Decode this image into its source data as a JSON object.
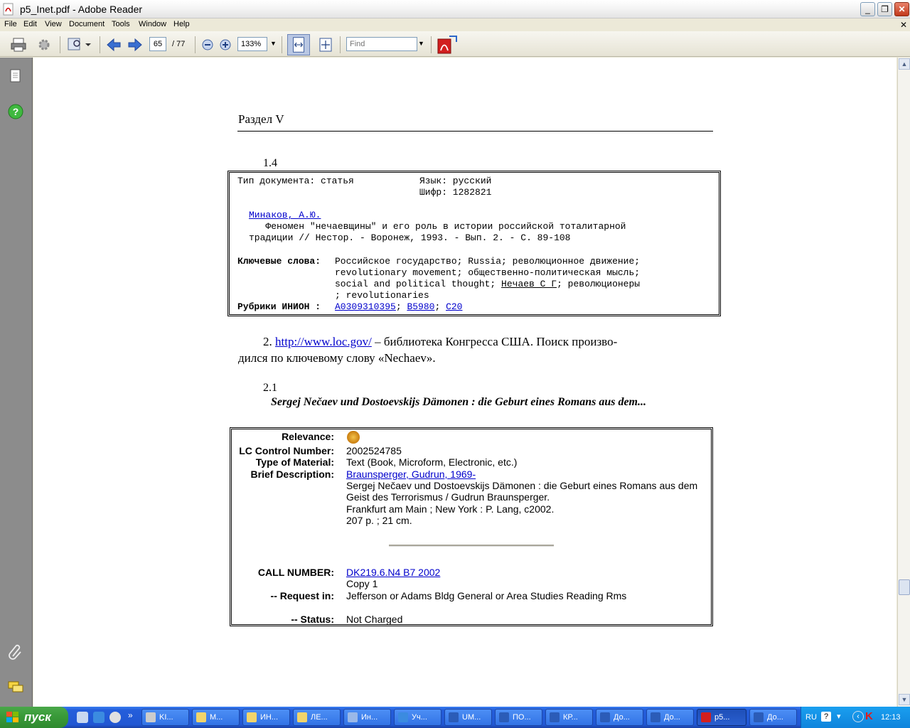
{
  "window": {
    "title": "p5_Inet.pdf - Adobe Reader",
    "menu": [
      "File",
      "Edit",
      "View",
      "Document",
      "Tools",
      "Window",
      "Help"
    ]
  },
  "toolbar": {
    "page_current": "65",
    "page_total": "/ 77",
    "zoom": "133%",
    "find_placeholder": "Find"
  },
  "page": {
    "section_title": "Раздел V",
    "item_1_4": "1.4",
    "record1": {
      "doc_type": "Тип документа: статья",
      "language": "Язык: русский",
      "cipher": "Шифр: 1282821",
      "author": "Минаков, А.Ю.",
      "title_line1": "   Феномен \"нечаевщины\" и его роль в истории российской тоталитарной",
      "title_line2": "традиции // Нестор. - Воронеж, 1993. - Вып. 2. - С. 89-108",
      "keywords_label": "Ключевые слова:",
      "keywords_line1": "Российское государство; Russia; революционное движение;",
      "keywords_line2": "revolutionary movement; общественно-политическая мысль;",
      "keywords_line3a": "social and political thought; ",
      "keywords_line3b": "Нечаев С Г",
      "keywords_line3c": "; революционеры",
      "keywords_line4": "; revolutionaries",
      "rubrics_label": "Рубрики ИНИОН :",
      "rubric1": "А0309310395",
      "rubric2": "В5980",
      "rubric3": "С20"
    },
    "para2_num": "2.",
    "para2_link": "http://www.loc.gov/",
    "para2_text1": " – библиотека Конгресса США. Поиск произво-",
    "para2_text2": "дился по ключевому слову «Nechaev».",
    "item_2_1": "2.1",
    "book_title": "Sergej Nečaev und Dostoevskijs Dämonen : die Geburt eines Romans aus dem...",
    "record2": {
      "relevance_label": "Relevance:",
      "lccn_label": "LC Control Number:",
      "lccn": "2002524785",
      "type_label": "Type of Material:",
      "type": "Text (Book, Microform, Electronic, etc.)",
      "brief_label": "Brief Description:",
      "author_link": "Braunsperger, Gudrun, 1969-",
      "desc1": "Sergej Nečaev und Dostoevskijs Dämonen : die Geburt eines Romans aus dem",
      "desc2": "Geist des Terrorismus / Gudrun Braunsperger.",
      "desc3": "Frankfurt am Main ; New York : P. Lang, c2002.",
      "desc4": "207 p. ; 21 cm.",
      "call_label": "CALL NUMBER:",
      "call_link": "DK219.6.N4 B7 2002",
      "copy": "Copy 1",
      "request_label": "-- Request in:",
      "request": "Jefferson or Adams Bldg General or Area Studies Reading Rms",
      "status_label": "-- Status:",
      "status": "Not Charged"
    }
  },
  "taskbar": {
    "start": "пуск",
    "tasks": [
      "KI...",
      "М...",
      "ИН...",
      "ЛЕ...",
      "Ин...",
      "Уч...",
      "UM...",
      "ПО...",
      "КР...",
      "До...",
      "До...",
      "p5...",
      "До..."
    ],
    "lang": "RU",
    "clock": "12:13"
  },
  "colors": {
    "link": "#0000cc",
    "nav_panel": "#8c8c8c",
    "taskbar": "#245edb",
    "start_button": "#3a9b3a"
  }
}
